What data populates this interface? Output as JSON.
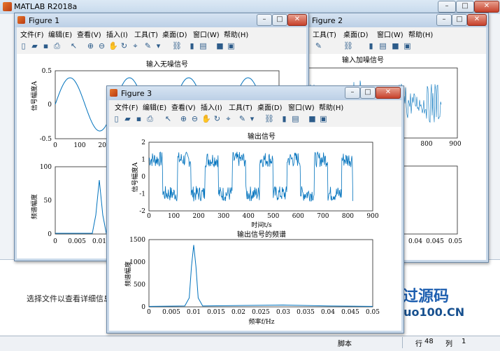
{
  "app": {
    "title": "MATLAB R2018a"
  },
  "detail_text": "选择文件以查看详细信息",
  "status": {
    "script": "脚本",
    "row_label": "行",
    "row": "48",
    "col_label": "列",
    "col": "1"
  },
  "menu": [
    "文件(F)",
    "编辑(E)",
    "查看(V)",
    "插入(I)",
    "工具(T)",
    "桌面(D)",
    "窗口(W)",
    "帮助(H)"
  ],
  "toolbar_icons": [
    "new-figure-icon",
    "open-icon",
    "save-icon",
    "print-icon",
    "pointer-icon",
    "zoom-in-icon",
    "zoom-out-icon",
    "pan-icon",
    "rotate-icon",
    "data-cursor-icon",
    "brush-icon",
    "link-icon",
    "colorbar-icon",
    "legend-icon",
    "hide-plot-tools-icon",
    "show-plot-tools-icon"
  ],
  "watermark": {
    "line1": "必过源码",
    "line2": "Biguo100.CN"
  },
  "figure1": {
    "title": "Figure 1",
    "plot1": {
      "title": "输入无噪信号",
      "ylabel": "信号幅度A",
      "yticks": [
        "0.5",
        "0",
        "-0.5"
      ],
      "xticks": [
        "0",
        "100",
        "200"
      ]
    },
    "plot2": {
      "ylabel": "频谱幅度",
      "yticks": [
        "100",
        "50",
        "0"
      ],
      "xticks": [
        "0",
        "0.005",
        "0.01"
      ]
    }
  },
  "figure2": {
    "title": "Figure 2",
    "plot1": {
      "title": "输入加噪信号",
      "xticks": [
        "700",
        "800",
        "900"
      ]
    },
    "plot2": {
      "xticks": [
        "0.04",
        "0.045",
        "0.05"
      ]
    }
  },
  "figure3": {
    "title": "Figure 3",
    "plot1": {
      "title": "输出信号",
      "xlabel": "时间t/s",
      "ylabel": "信号幅度A",
      "xticks": [
        "0",
        "100",
        "200",
        "300",
        "400",
        "500",
        "600",
        "700",
        "800",
        "900"
      ],
      "yticks": [
        "2",
        "1",
        "0",
        "-1",
        "-2"
      ]
    },
    "plot2": {
      "title": "输出信号的频谱",
      "xlabel": "频率f/Hz",
      "ylabel": "频谱幅度",
      "xticks": [
        "0",
        "0.005",
        "0.01",
        "0.015",
        "0.02",
        "0.025",
        "0.03",
        "0.035",
        "0.04",
        "0.045",
        "0.05"
      ],
      "yticks": [
        "1500",
        "1000",
        "500",
        "0"
      ]
    }
  },
  "chart_data": [
    {
      "type": "line",
      "title": "输出信号",
      "xlabel": "时间t/s",
      "ylabel": "信号幅度A",
      "xlim": [
        0,
        900
      ],
      "ylim": [
        -2,
        2
      ],
      "series": [
        {
          "description": "noisy square wave, period ~110",
          "x": [
            0,
            50,
            55,
            110,
            115,
            165,
            170,
            220,
            225,
            275,
            280,
            330,
            335,
            385,
            390,
            440,
            445,
            495,
            500,
            550,
            555,
            605,
            610,
            660,
            665,
            715,
            720,
            770,
            775,
            820
          ],
          "values": [
            1,
            1,
            -1,
            -1,
            1,
            1,
            -1,
            -1,
            1,
            1,
            -1,
            -1,
            1,
            1,
            -1,
            -1,
            1,
            1,
            -1,
            -1,
            1,
            1,
            -1,
            -1,
            1,
            1,
            -1,
            -1,
            1,
            -1
          ]
        }
      ]
    },
    {
      "type": "line",
      "title": "输出信号的频谱",
      "xlabel": "频率f/Hz",
      "ylabel": "频谱幅度",
      "xlim": [
        0,
        0.05
      ],
      "ylim": [
        0,
        1500
      ],
      "series": [
        {
          "x": [
            0,
            0.005,
            0.008,
            0.009,
            0.0095,
            0.01,
            0.0105,
            0.011,
            0.012,
            0.02,
            0.03,
            0.04,
            0.05
          ],
          "values": [
            10,
            15,
            20,
            200,
            900,
            1380,
            900,
            200,
            20,
            30,
            40,
            20,
            10
          ]
        }
      ]
    }
  ]
}
